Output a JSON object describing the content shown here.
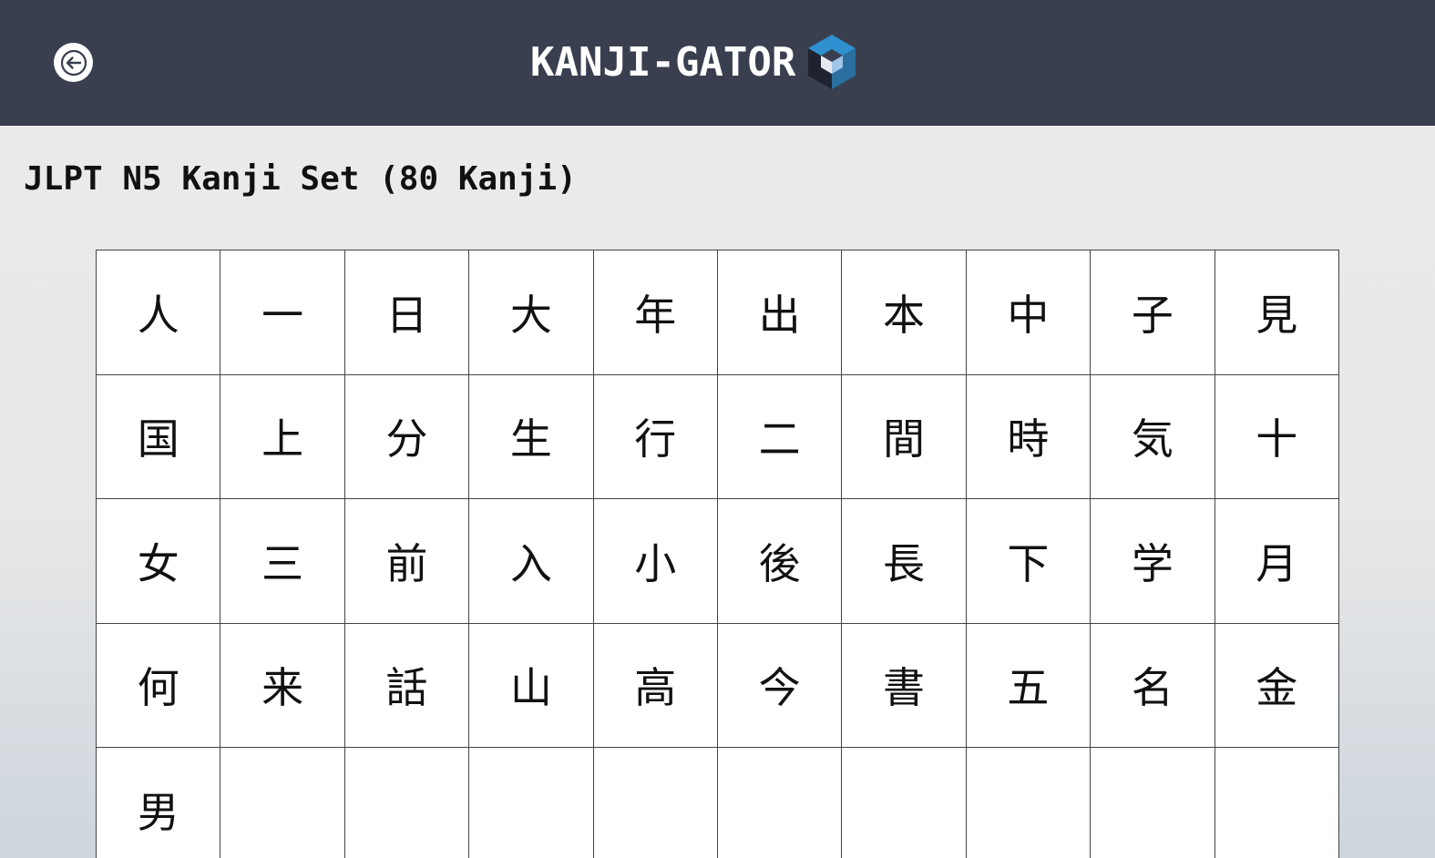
{
  "header": {
    "brand_name": "KANJI-GATOR",
    "back_icon": "arrow-left-icon",
    "logo_icon": "hexagon-cube-logo",
    "background_color": "#3a3f50",
    "logo_accent_color": "#2f8fcf"
  },
  "set": {
    "title": "JLPT N5 Kanji Set (80 Kanji)"
  },
  "kanji": [
    "人",
    "一",
    "日",
    "大",
    "年",
    "出",
    "本",
    "中",
    "子",
    "見",
    "国",
    "上",
    "分",
    "生",
    "行",
    "二",
    "間",
    "時",
    "気",
    "十",
    "女",
    "三",
    "前",
    "入",
    "小",
    "後",
    "長",
    "下",
    "学",
    "月",
    "何",
    "来",
    "話",
    "山",
    "高",
    "今",
    "書",
    "五",
    "名",
    "金",
    "男",
    "",
    "",
    "",
    "",
    "",
    "",
    "",
    "",
    ""
  ]
}
